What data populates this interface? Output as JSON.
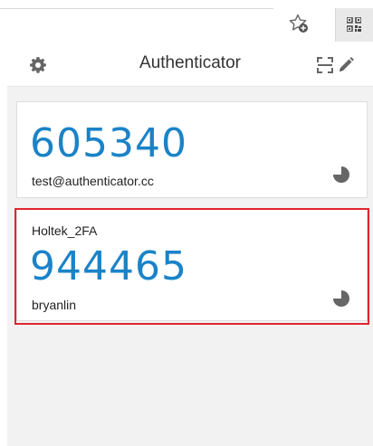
{
  "header": {
    "title": "Authenticator"
  },
  "icons": {
    "browser_star": "star-plus-icon",
    "browser_extension": "qr-code-icon",
    "settings": "gear-icon",
    "scan": "scan-icon",
    "edit": "pencil-icon",
    "timer": "timer-pie-icon"
  },
  "colors": {
    "code": "#1a83c8",
    "highlight": "#e0262f",
    "background": "#f2f2f2"
  },
  "entries": [
    {
      "issuer": "",
      "code": "605340",
      "account": "test@authenticator.cc"
    },
    {
      "issuer": "Holtek_2FA",
      "code": "944465",
      "account": "bryanlin"
    }
  ]
}
